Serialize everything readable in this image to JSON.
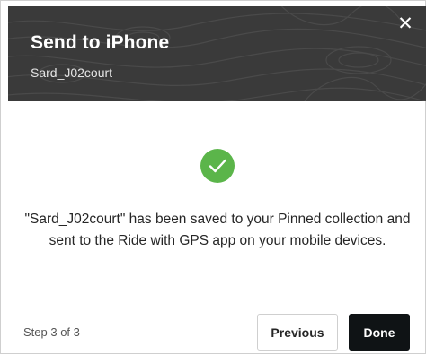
{
  "dialog": {
    "title": "Send to iPhone",
    "subtitle": "Sard_J02court",
    "close_glyph": "✕",
    "message": "\"Sard_J02court\" has been saved to your Pinned collection and sent to the Ride with GPS app on your mobile devices.",
    "step_text": "Step 3 of 3",
    "previous_label": "Previous",
    "done_label": "Done"
  },
  "icons": {
    "close": "close-icon",
    "success": "checkmark-circle-icon"
  },
  "colors": {
    "header_bg": "#3a3a3a",
    "success_green": "#5bb54a",
    "done_button_bg": "#0f1315"
  }
}
